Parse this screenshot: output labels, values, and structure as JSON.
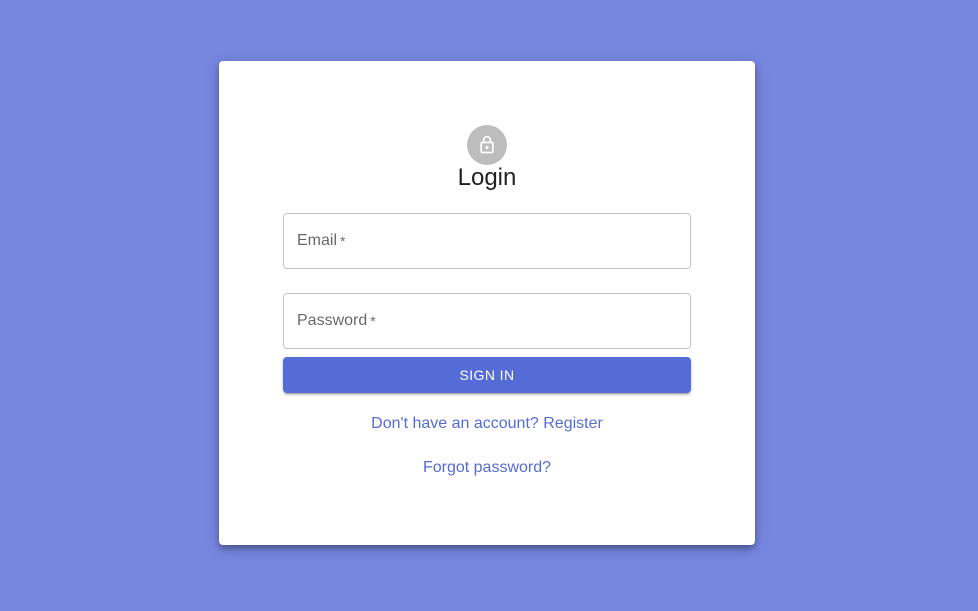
{
  "page": {
    "background_color": "#7787e0",
    "card_color": "#ffffff",
    "accent_color": "#556cd6"
  },
  "header": {
    "icon": "lock-icon",
    "title": "Login"
  },
  "form": {
    "email": {
      "label": "Email",
      "required_mark": "*",
      "value": ""
    },
    "password": {
      "label": "Password",
      "required_mark": "*",
      "value": ""
    },
    "submit_label": "SIGN IN"
  },
  "links": {
    "register": "Don't have an account? Register",
    "forgot_password": "Forgot password?"
  }
}
